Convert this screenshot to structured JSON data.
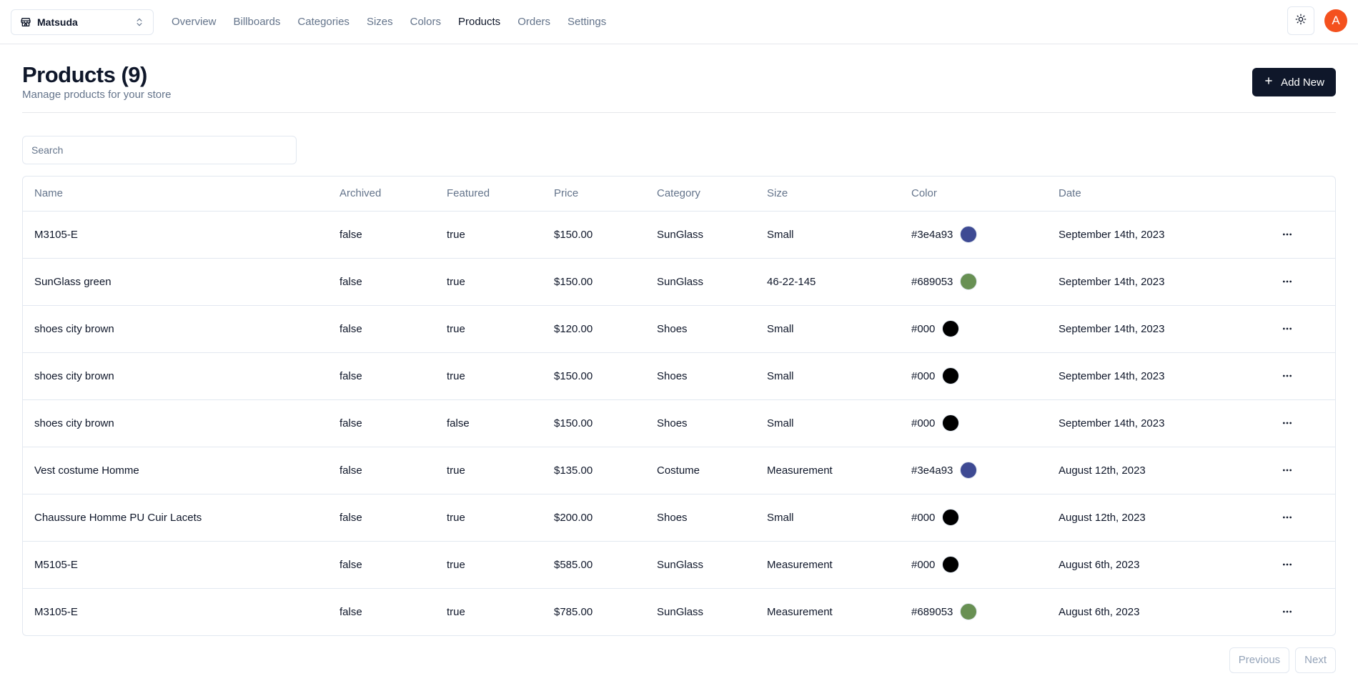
{
  "store_switcher": {
    "name": "Matsuda",
    "icon": "store-icon",
    "chevron_icon": "chevrons-up-down-icon"
  },
  "nav": {
    "items": [
      "Overview",
      "Billboards",
      "Categories",
      "Sizes",
      "Colors",
      "Products",
      "Orders",
      "Settings"
    ],
    "active": "Products"
  },
  "theme_toggle": {
    "icon": "sun-icon"
  },
  "user": {
    "avatar_letter": "A",
    "avatar_color": "#f4511e"
  },
  "header": {
    "title": "Products (9)",
    "subtitle": "Manage products for your store",
    "add_button_label": "Add New",
    "add_button_icon": "plus-icon"
  },
  "search": {
    "placeholder": "Search",
    "value": ""
  },
  "table": {
    "columns": [
      "Name",
      "Archived",
      "Featured",
      "Price",
      "Category",
      "Size",
      "Color",
      "Date"
    ],
    "rows": [
      {
        "name": "M3105-E",
        "archived": "false",
        "featured": "true",
        "price": "$150.00",
        "category": "SunGlass",
        "size": "Small",
        "color": "#3e4a93",
        "date": "September 14th, 2023"
      },
      {
        "name": "SunGlass green",
        "archived": "false",
        "featured": "true",
        "price": "$150.00",
        "category": "SunGlass",
        "size": "46-22-145",
        "color": "#689053",
        "date": "September 14th, 2023"
      },
      {
        "name": "shoes city brown",
        "archived": "false",
        "featured": "true",
        "price": "$120.00",
        "category": "Shoes",
        "size": "Small",
        "color": "#000",
        "date": "September 14th, 2023"
      },
      {
        "name": "shoes city brown",
        "archived": "false",
        "featured": "true",
        "price": "$150.00",
        "category": "Shoes",
        "size": "Small",
        "color": "#000",
        "date": "September 14th, 2023"
      },
      {
        "name": "shoes city brown",
        "archived": "false",
        "featured": "false",
        "price": "$150.00",
        "category": "Shoes",
        "size": "Small",
        "color": "#000",
        "date": "September 14th, 2023"
      },
      {
        "name": "Vest costume Homme",
        "archived": "false",
        "featured": "true",
        "price": "$135.00",
        "category": "Costume",
        "size": "Measurement",
        "color": "#3e4a93",
        "date": "August 12th, 2023"
      },
      {
        "name": "Chaussure Homme PU Cuir Lacets",
        "archived": "false",
        "featured": "true",
        "price": "$200.00",
        "category": "Shoes",
        "size": "Small",
        "color": "#000",
        "date": "August 12th, 2023"
      },
      {
        "name": "M5105-E",
        "archived": "false",
        "featured": "true",
        "price": "$585.00",
        "category": "SunGlass",
        "size": "Measurement",
        "color": "#000",
        "date": "August 6th, 2023"
      },
      {
        "name": "M3105-E",
        "archived": "false",
        "featured": "true",
        "price": "$785.00",
        "category": "SunGlass",
        "size": "Measurement",
        "color": "#689053",
        "date": "August 6th, 2023"
      }
    ],
    "row_action_icon": "more-horizontal-icon"
  },
  "pagination": {
    "previous_label": "Previous",
    "next_label": "Next"
  }
}
